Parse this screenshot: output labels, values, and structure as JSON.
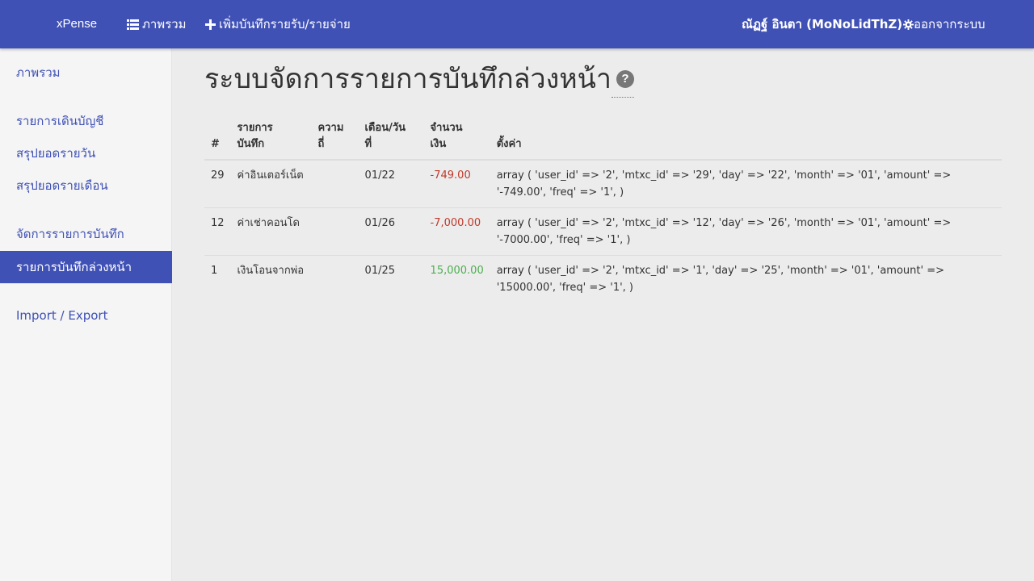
{
  "navbar": {
    "brand": "xPense",
    "overview": "ภาพรวม",
    "add_record": "เพิ่มบันทึกรายรับ/รายจ่าย",
    "user": "ณัฏฐ์ อินตา (MoNoLidThZ)",
    "logout": "ออกจากระบบ"
  },
  "sidebar": {
    "items": [
      {
        "label": "ภาพรวม"
      },
      {
        "label": "รายการเดินบัญชี"
      },
      {
        "label": "สรุปยอดรายวัน"
      },
      {
        "label": "สรุปยอดรายเดือน"
      },
      {
        "label": "จัดการรายการบันทึก"
      },
      {
        "label": "รายการบันทึกล่วงหน้า"
      },
      {
        "label": "Import / Export"
      }
    ],
    "active_index": 5
  },
  "page": {
    "title": "ระบบจัดการรายการบันทึกล่วงหน้า",
    "help_icon": "?"
  },
  "table": {
    "headers": {
      "num": "#",
      "name_1": "รายการ",
      "name_2": "บันทึก",
      "freq_1": "ความ",
      "freq_2": "ถี่",
      "date_1": "เดือน/วัน",
      "date_2": "ที่",
      "amount_1": "จำนวน",
      "amount_2": "เงิน",
      "settings": "ตั้งค่า"
    },
    "rows": [
      {
        "id": "29",
        "name": "ค่าอินเตอร์เน็ต",
        "freq": "",
        "date": "01/22",
        "amount": "-749.00",
        "amount_color": "#c0392b",
        "settings": "array ( 'user_id' => '2', 'mtxc_id' => '29', 'day' => '22', 'month' => '01', 'amount' => '-749.00', 'freq' => '1', )"
      },
      {
        "id": "12",
        "name": "ค่าเช่าคอนโด",
        "freq": "",
        "date": "01/26",
        "amount": "-7,000.00",
        "amount_color": "#c0392b",
        "settings": "array ( 'user_id' => '2', 'mtxc_id' => '12', 'day' => '26', 'month' => '01', 'amount' => '-7000.00', 'freq' => '1', )"
      },
      {
        "id": "1",
        "name": "เงินโอนจากพ่อ",
        "freq": "",
        "date": "01/25",
        "amount": "15,000.00",
        "amount_color": "#4caf50",
        "settings": "array ( 'user_id' => '2', 'mtxc_id' => '1', 'day' => '25', 'month' => '01', 'amount' => '15000.00', 'freq' => '1', )"
      }
    ]
  },
  "colors": {
    "primary": "#4051b5",
    "negative": "#c0392b",
    "positive": "#4caf50"
  }
}
